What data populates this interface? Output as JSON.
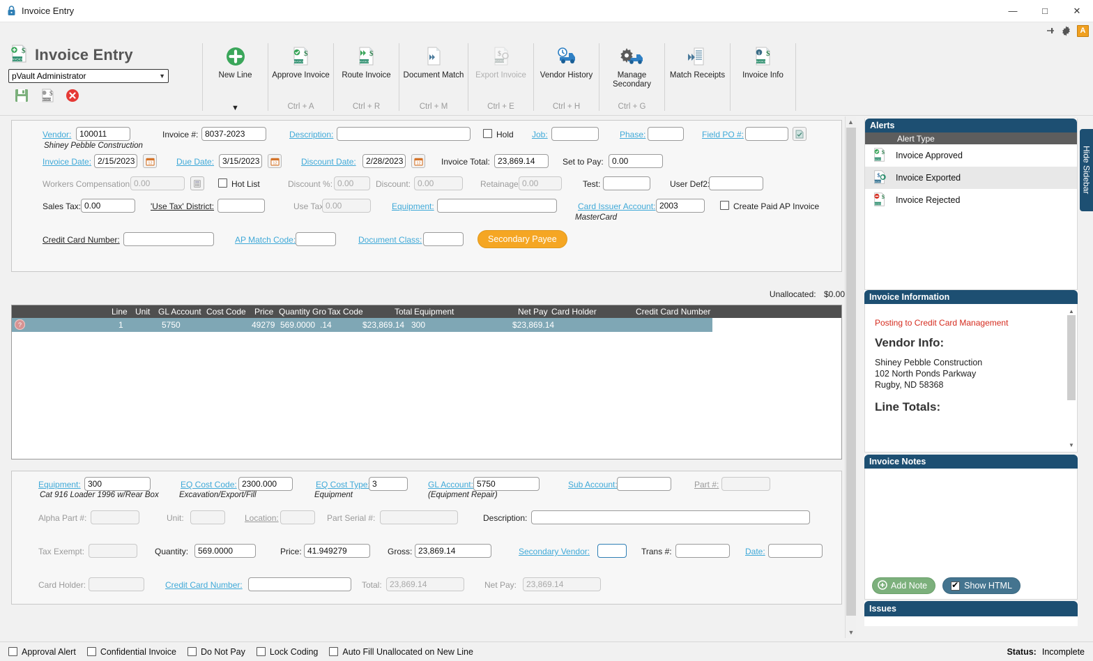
{
  "window": {
    "title": "Invoice Entry",
    "lock_icon": "lock-icon",
    "minimize": "—",
    "maximize": "□",
    "close": "✕"
  },
  "ribbon_tools": {
    "pin_icon": "pin-icon",
    "gear_icon": "gear-icon",
    "admin_badge": "A"
  },
  "brand": {
    "title": "Invoice Entry",
    "user": "pVault Administrator",
    "save_icon": "save-icon",
    "post_icon": "post-invoice-icon",
    "delete_icon": "delete-icon"
  },
  "toolbar": {
    "buttons": [
      {
        "label": "New Line",
        "shortcut": "",
        "icon": "plus-circle-icon",
        "disabled": false,
        "has_caret": true
      },
      {
        "label": "Approve Invoice",
        "shortcut": "Ctrl + A",
        "icon": "approve-invoice-icon",
        "disabled": false,
        "has_caret": false
      },
      {
        "label": "Route Invoice",
        "shortcut": "Ctrl + R",
        "icon": "route-invoice-icon",
        "disabled": false,
        "has_caret": false
      },
      {
        "label": "Document Match",
        "shortcut": "Ctrl + M",
        "icon": "document-match-icon",
        "disabled": false,
        "has_caret": false
      },
      {
        "label": "Export Invoice",
        "shortcut": "Ctrl + E",
        "icon": "export-invoice-icon",
        "disabled": true,
        "has_caret": false
      },
      {
        "label": "Vendor History",
        "shortcut": "Ctrl + H",
        "icon": "vendor-history-icon",
        "disabled": false,
        "has_caret": false
      },
      {
        "label": "Manage Secondary",
        "shortcut": "Ctrl + G",
        "icon": "manage-secondary-icon",
        "disabled": false,
        "has_caret": false
      },
      {
        "label": "Match Receipts",
        "shortcut": "",
        "icon": "match-receipts-icon",
        "disabled": false,
        "has_caret": false
      },
      {
        "label": "Invoice Info",
        "shortcut": "",
        "icon": "invoice-info-icon",
        "disabled": false,
        "has_caret": false
      }
    ]
  },
  "header_form": {
    "vendor_label": "Vendor:",
    "vendor_value": "100011",
    "vendor_name": "Shiney Pebble Construction",
    "invoice_no_label": "Invoice #:",
    "invoice_no_value": "8037-2023",
    "description_label": "Description:",
    "description_value": "",
    "hold_label": "Hold",
    "job_label": "Job:",
    "job_value": "",
    "phase_label": "Phase:",
    "phase_value": "",
    "field_po_label": "Field PO #:",
    "field_po_value": "",
    "invoice_date_label": "Invoice Date:",
    "invoice_date_value": "2/15/2023",
    "due_date_label": "Due Date:",
    "due_date_value": "3/15/2023",
    "discount_date_label": "Discount Date:",
    "discount_date_value": "2/28/2023",
    "invoice_total_label": "Invoice Total:",
    "invoice_total_value": "23,869.14",
    "set_to_pay_label": "Set to Pay:",
    "set_to_pay_value": "0.00",
    "workers_comp_label": "Workers Compensation:",
    "workers_comp_value": "0.00",
    "hot_list_label": "Hot List",
    "discount_pct_label": "Discount %:",
    "discount_pct_value": "0.00",
    "discount_label": "Discount:",
    "discount_value": "0.00",
    "retainage_label": "Retainage:",
    "retainage_value": "0.00",
    "test_label": "Test:",
    "test_value": "",
    "user_def2_label": "User Def2:",
    "user_def2_value": "",
    "sales_tax_label": "Sales Tax:",
    "sales_tax_value": "0.00",
    "use_tax_district_label": "'Use Tax' District:",
    "use_tax_district_value": "",
    "use_tax_label": "Use Tax:",
    "use_tax_value": "0.00",
    "equipment_label": "Equipment:",
    "equipment_value": "",
    "card_issuer_label": "Card Issuer Account:",
    "card_issuer_value": "2003",
    "card_issuer_name": "MasterCard",
    "create_paid_label": "Create Paid AP Invoice",
    "credit_card_number_label": "Credit Card Number:",
    "credit_card_number_value": "",
    "ap_match_code_label": "AP Match Code:",
    "ap_match_code_value": "",
    "document_class_label": "Document Class:",
    "document_class_value": "",
    "secondary_payee_btn": "Secondary Payee"
  },
  "unallocated": {
    "label": "Unallocated:",
    "value": "$0.00"
  },
  "grid": {
    "columns": [
      "Line",
      "Unit",
      "GL Account",
      "Cost Code",
      "Price",
      "Quantity",
      "Gro",
      "Tax Code",
      "Total",
      "Equipment",
      "Net Pay",
      "Card Holder",
      "Credit Card Number"
    ],
    "rows": [
      {
        "line": "1",
        "unit": "",
        "gl_account": "5750",
        "cost_code": "",
        "price": "49279",
        "quantity": "569.0000",
        "gross": "",
        "tax_code": ".14",
        "total": "$23,869.14",
        "equipment": "300",
        "net_pay": "$23,869.14",
        "card_holder": "",
        "credit_card_number": "",
        "icons": [
          "add-line-icon",
          "copy-line-icon",
          "refresh-line-icon",
          "dollar-line-icon",
          "delete-line-icon",
          "help-line-icon"
        ]
      }
    ]
  },
  "detail_form": {
    "equipment_label": "Equipment:",
    "equipment_value": "300",
    "equipment_desc": "Cat 916 Loader 1996 w/Rear Box",
    "eq_cost_code_label": "EQ Cost Code:",
    "eq_cost_code_value": "2300.000",
    "eq_cost_code_desc": "Excavation/Export/Fill",
    "eq_cost_type_label": "EQ Cost Type:",
    "eq_cost_type_value": "3",
    "eq_cost_type_desc": "Equipment",
    "gl_account_label": "GL Account:",
    "gl_account_value": "5750",
    "gl_account_desc": "(Equipment Repair)",
    "sub_account_label": "Sub Account:",
    "sub_account_value": "",
    "part_no_label": "Part #:",
    "part_no_value": "",
    "alpha_part_label": "Alpha Part #:",
    "alpha_part_value": "",
    "unit_label": "Unit:",
    "unit_value": "",
    "location_label": "Location:",
    "location_value": "",
    "part_serial_label": "Part Serial #:",
    "part_serial_value": "",
    "description_label": "Description:",
    "description_value": "",
    "tax_exempt_label": "Tax Exempt:",
    "tax_exempt_value": "",
    "quantity_label": "Quantity:",
    "quantity_value": "569.0000",
    "price_label": "Price:",
    "price_value": "41.949279",
    "gross_label": "Gross:",
    "gross_value": "23,869.14",
    "secondary_vendor_label": "Secondary Vendor:",
    "secondary_vendor_value": "",
    "trans_no_label": "Trans #:",
    "trans_no_value": "",
    "date_label": "Date:",
    "date_value": "",
    "card_holder_label": "Card Holder:",
    "card_holder_value": "",
    "credit_card_number_label": "Credit Card Number:",
    "credit_card_number_value": "",
    "total_label": "Total:",
    "total_value": "23,869.14",
    "net_pay_label": "Net Pay:",
    "net_pay_value": "23,869.14"
  },
  "sidebar": {
    "hide_label": "Hide Sidebar",
    "alerts": {
      "title": "Alerts",
      "col_header": "Alert Type",
      "items": [
        {
          "label": "Invoice Approved",
          "icon": "invoice-approved-icon",
          "selected": false
        },
        {
          "label": "Invoice Exported",
          "icon": "invoice-exported-icon",
          "selected": true
        },
        {
          "label": "Invoice Rejected",
          "icon": "invoice-rejected-icon",
          "selected": false
        }
      ]
    },
    "invoice_information": {
      "title": "Invoice Information",
      "posting_note": "Posting to Credit Card Management",
      "vendor_heading": "Vendor Info:",
      "vendor_lines": [
        "Shiney Pebble Construction",
        "102 North Ponds Parkway",
        "Rugby, ND 58368"
      ],
      "line_totals_heading": "Line Totals:"
    },
    "invoice_notes": {
      "title": "Invoice Notes",
      "body": "",
      "add_note_label": "Add Note",
      "show_html_label": "Show HTML",
      "show_html_checked": true
    },
    "issues": {
      "title": "Issues"
    }
  },
  "statusbar": {
    "checkboxes": [
      {
        "label": "Approval Alert",
        "checked": false
      },
      {
        "label": "Confidential Invoice",
        "checked": false
      },
      {
        "label": "Do Not Pay",
        "checked": false
      },
      {
        "label": "Lock Coding",
        "checked": false
      },
      {
        "label": "Auto Fill Unallocated on New Line",
        "checked": false
      }
    ],
    "status_label": "Status:",
    "status_value": "Incomplete"
  },
  "colors": {
    "accent_blue": "#1d4f72",
    "link_blue": "#3fa9d8",
    "orange": "#f5a623",
    "grid_header": "#4f4f4f",
    "grid_row_sel": "#7fa7b5",
    "alert_red": "#d52b1e",
    "green": "#7cb07c"
  }
}
